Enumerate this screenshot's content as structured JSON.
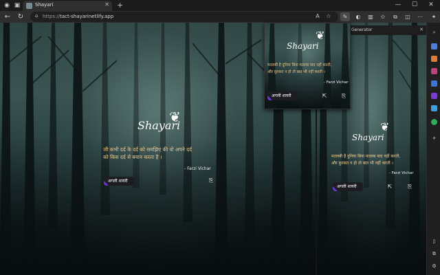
{
  "tab": {
    "title": "Shayari",
    "close": "✕",
    "new": "+"
  },
  "window": {
    "minimize": "—",
    "maximize": "☐",
    "close": "✕"
  },
  "toolbar": {
    "url_prefix": "https://",
    "url_host": "tact-shayarinetlify.app",
    "lock": "🔒"
  },
  "side_panel": {
    "title": "Generator",
    "close": "✕"
  },
  "main_card": {
    "logo": "Shayari",
    "quote_line1": "जी कभी दर्द के दर्द को समझिए की वो अपने दर्द",
    "quote_line2": "को किस दर्द से बयान करता है ।",
    "author": "- Farzi Vichar",
    "next_label": "अगली शायरी"
  },
  "popup_card": {
    "logo": "Shayari",
    "quote_line1": "मतलबी है दुनिया बिना मतलब याद नहीं करती,",
    "quote_line2": "और फ़ुरसत न हो तो बात भी नहीं करती ।",
    "author": "- Farzi Vichar",
    "next_label": "अगली शायरी"
  },
  "side_card": {
    "logo": "Shayari",
    "quote_line1": "मतलबी है दुनिया बिना मतलब याद नहीं करती,",
    "quote_line2": "और फ़ुरसत न हो तो बात भी नहीं करती ।",
    "author": "- Farzi Vichar",
    "next_label": "अगली शायरी"
  },
  "colors": {
    "quote": "#f0c98a",
    "accent": "#6a34d6",
    "button_bg": "#1c1c22"
  }
}
